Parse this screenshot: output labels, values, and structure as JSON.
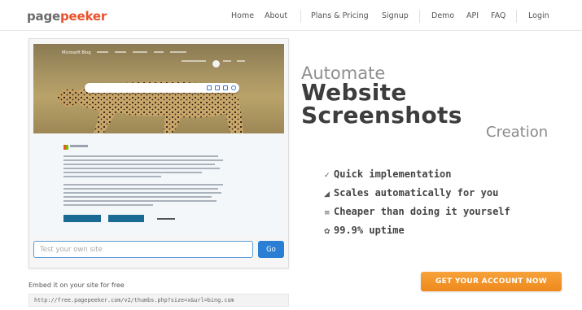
{
  "brand": {
    "part1": "page",
    "part2": "peeker"
  },
  "nav": {
    "home": "Home",
    "about": "About",
    "plans": "Plans & Pricing",
    "signup": "Signup",
    "demo": "Demo",
    "api": "API",
    "faq": "FAQ",
    "login": "Login"
  },
  "preview": {
    "site_brand": "Microsoft Bing",
    "url_placeholder": "Test your own site",
    "go_label": "Go"
  },
  "embed": {
    "label": "Embed it on your site for free",
    "code": "http://free.pagepeeker.com/v2/thumbs.php?size=x&url=bing.com"
  },
  "headline": {
    "line1": "Automate",
    "line2": "Website",
    "line3": "Screenshots",
    "line4": "Creation"
  },
  "features": [
    {
      "icon": "pencil-icon",
      "glyph": "✓",
      "text": "Quick implementation"
    },
    {
      "icon": "chart-icon",
      "glyph": "◢",
      "text": "Scales automatically for you"
    },
    {
      "icon": "list-icon",
      "glyph": "≡",
      "text": "Cheaper than doing it yourself"
    },
    {
      "icon": "gear-icon",
      "glyph": "✿",
      "text": "99.9% uptime"
    }
  ],
  "cta": {
    "label": "GET YOUR ACCOUNT NOW"
  },
  "colors": {
    "brand_orange": "#e8522c",
    "cta_orange": "#f2921f",
    "go_blue": "#2a7fd4"
  }
}
